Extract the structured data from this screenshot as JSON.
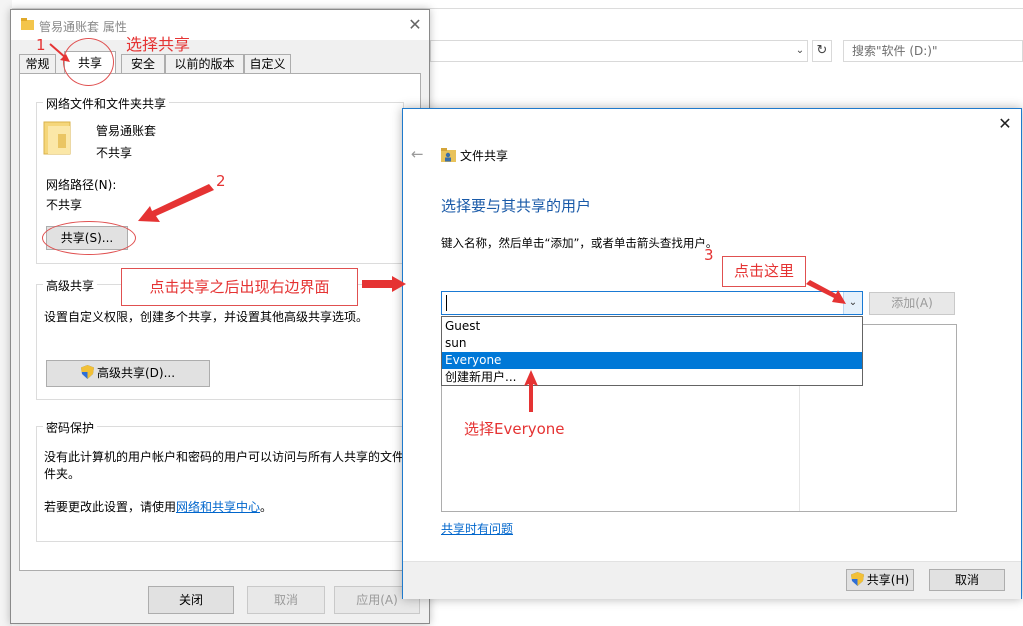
{
  "background": {
    "search_placeholder": "搜索\"软件 (D:)\""
  },
  "props": {
    "title": "管易通账套 属性",
    "tabs": [
      "常规",
      "共享",
      "安全",
      "以前的版本",
      "自定义"
    ],
    "active_tab": "共享",
    "network_group": {
      "title": "网络文件和文件夹共享",
      "folder_name": "管易通账套",
      "folder_status": "不共享",
      "path_label": "网络路径(N):",
      "path_value": "不共享",
      "share_button": "共享(S)..."
    },
    "advanced_group": {
      "title": "高级共享",
      "description": "设置自定义权限，创建多个共享，并设置其他高级共享选项。",
      "button": "高级共享(D)..."
    },
    "password_group": {
      "title": "密码保护",
      "description_line1": "没有此计算机的用户帐户和密码的用户可以访问与所有人共享的文件",
      "description_line2": "件夹。",
      "change_prefix": "若要更改此设置，请使用",
      "change_link": "网络和共享中心",
      "change_suffix": "。"
    },
    "footer": {
      "close": "关闭",
      "cancel": "取消",
      "apply": "应用(A)"
    }
  },
  "share_dialog": {
    "title": "文件共享",
    "heading": "选择要与其共享的用户",
    "instruction": "键入名称，然后单击“添加”，或者单击箭头查找用户。",
    "add_button": "添加(A)",
    "dropdown_items": [
      "Guest",
      "sun",
      "Everyone",
      "创建新用户..."
    ],
    "selected_item": "Everyone",
    "help_link": "共享时有问题",
    "share_button": "共享(H)",
    "cancel_button": "取消"
  },
  "annotations": {
    "step1_num": "1",
    "step1_text": "选择共享",
    "step2_num": "2",
    "step3_num": "3",
    "step3_text": "点击这里",
    "note_center": "点击共享之后出现右边界面",
    "note_everyone": "选择Everyone"
  },
  "colors": {
    "accent": "#0078d7",
    "annotation": "#e53333",
    "heading_blue": "#1a5aa8",
    "link": "#0066cc"
  }
}
